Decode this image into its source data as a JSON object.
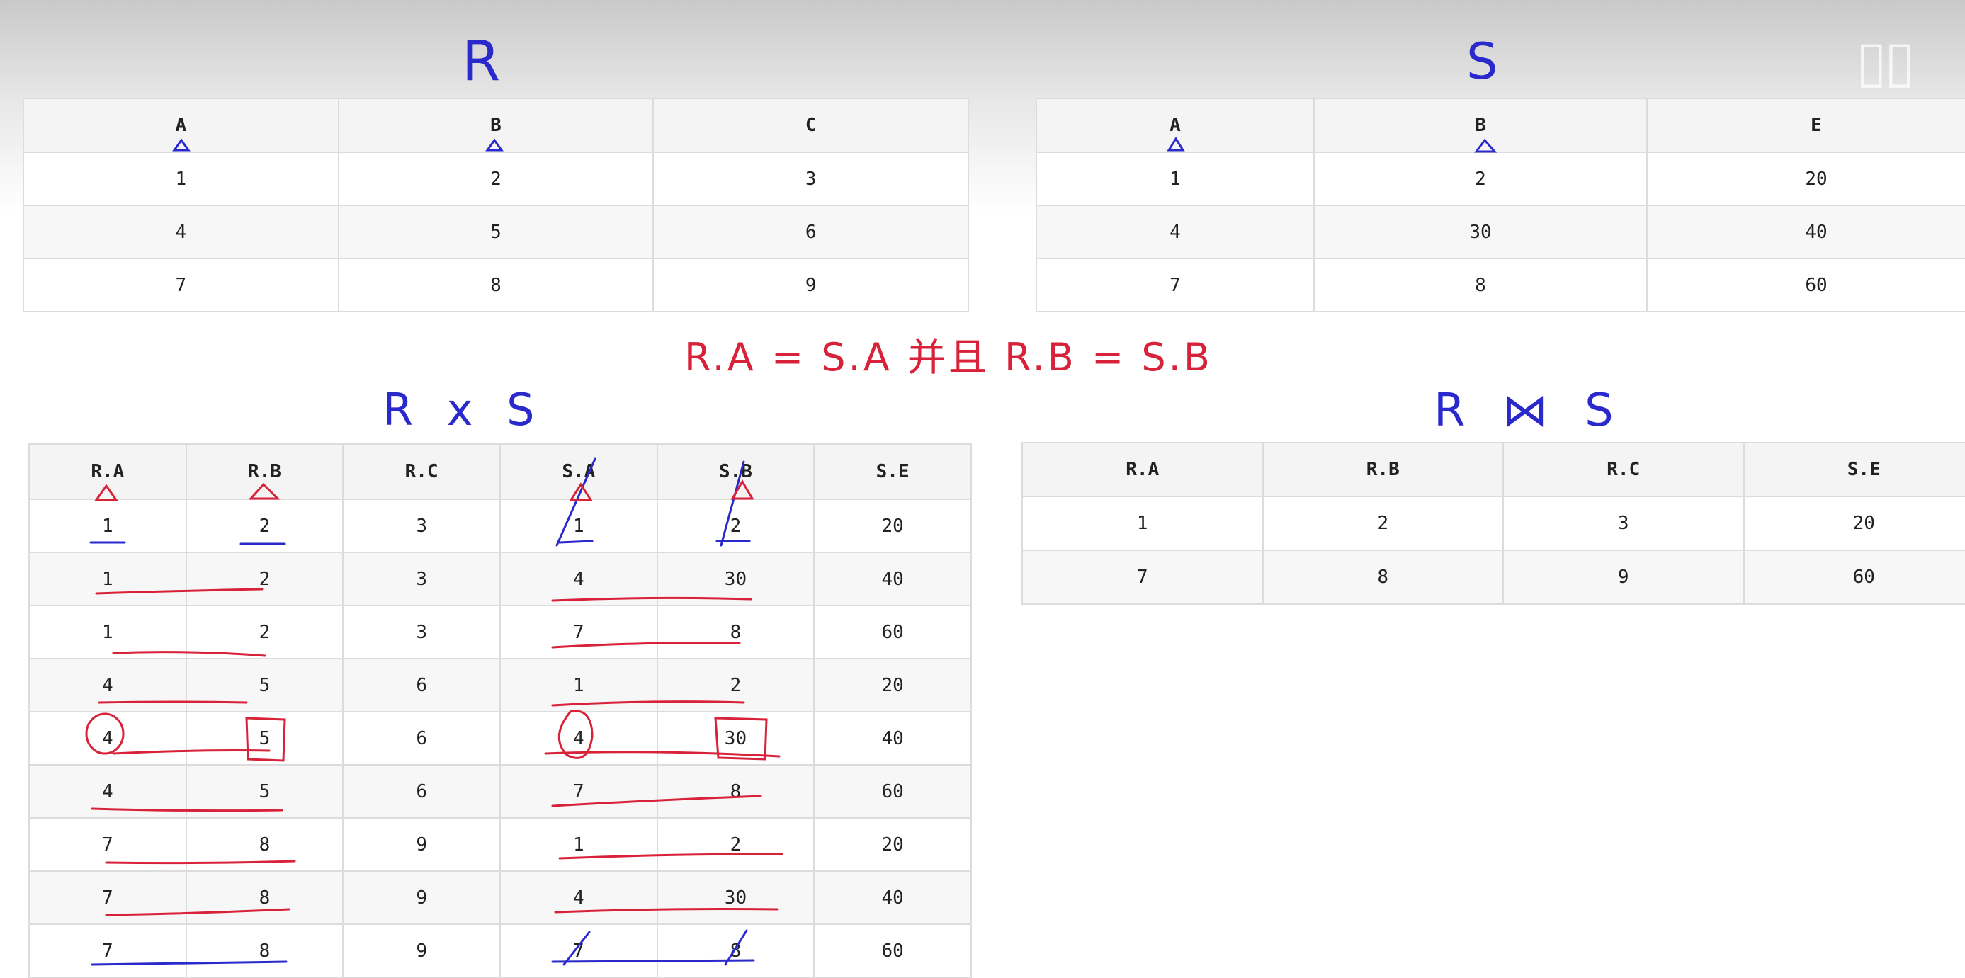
{
  "handwriting": {
    "title_r": "R",
    "title_s": "S",
    "title_rxs": "R x S",
    "title_join": "R ⋈ S",
    "condition": "R.A = S.A 并且 R.B = S.B"
  },
  "table_r": {
    "headers": [
      "A",
      "B",
      "C"
    ],
    "rows": [
      [
        "1",
        "2",
        "3"
      ],
      [
        "4",
        "5",
        "6"
      ],
      [
        "7",
        "8",
        "9"
      ]
    ]
  },
  "table_s": {
    "headers": [
      "A",
      "B",
      "E"
    ],
    "rows": [
      [
        "1",
        "2",
        "20"
      ],
      [
        "4",
        "30",
        "40"
      ],
      [
        "7",
        "8",
        "60"
      ]
    ]
  },
  "table_rxs": {
    "headers": [
      "R.A",
      "R.B",
      "R.C",
      "S.A",
      "S.B",
      "S.E"
    ],
    "rows": [
      [
        "1",
        "2",
        "3",
        "1",
        "2",
        "20"
      ],
      [
        "1",
        "2",
        "3",
        "4",
        "30",
        "40"
      ],
      [
        "1",
        "2",
        "3",
        "7",
        "8",
        "60"
      ],
      [
        "4",
        "5",
        "6",
        "1",
        "2",
        "20"
      ],
      [
        "4",
        "5",
        "6",
        "4",
        "30",
        "40"
      ],
      [
        "4",
        "5",
        "6",
        "7",
        "8",
        "60"
      ],
      [
        "7",
        "8",
        "9",
        "1",
        "2",
        "20"
      ],
      [
        "7",
        "8",
        "9",
        "4",
        "30",
        "40"
      ],
      [
        "7",
        "8",
        "9",
        "7",
        "8",
        "60"
      ]
    ]
  },
  "table_join": {
    "headers": [
      "R.A",
      "R.B",
      "R.C",
      "S.E"
    ],
    "rows": [
      [
        "1",
        "2",
        "3",
        "20"
      ],
      [
        "7",
        "8",
        "9",
        "60"
      ]
    ]
  },
  "colors": {
    "ink_blue": "#2a2acc",
    "ink_red": "#d8223a",
    "grid": "#dcdcdc",
    "header_bg": "#f4f4f4"
  }
}
